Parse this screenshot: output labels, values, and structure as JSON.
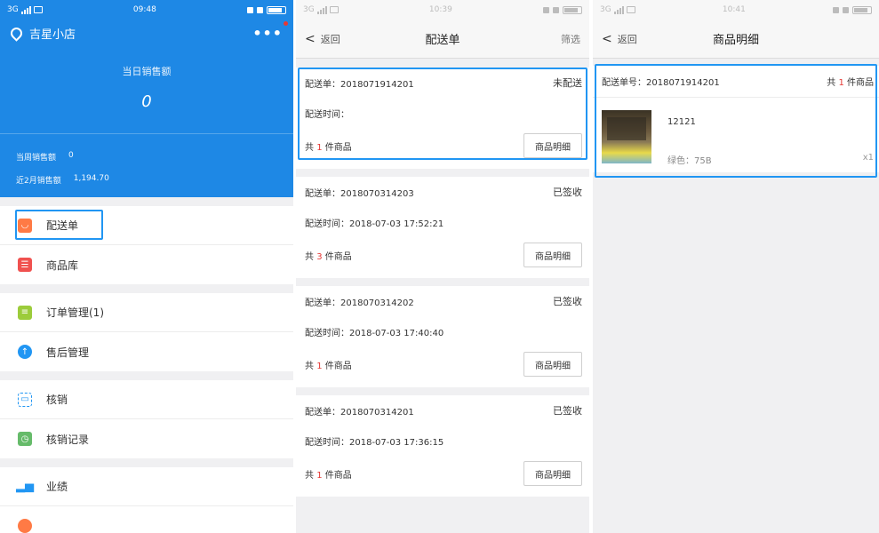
{
  "colors": {
    "primary_blue": "#1e88e5",
    "highlight_border": "#2196f3",
    "count_red": "#e53935"
  },
  "screen1": {
    "status": {
      "network": "3G",
      "time": "09:48"
    },
    "shop_name": "吉星小店",
    "more_label": "•••",
    "daily_sales_label": "当日销售额",
    "daily_sales_value": "0",
    "week_sales_label": "当周销售额",
    "week_sales_value": "0",
    "recent_sales_label": "近2月销售额",
    "recent_sales_value": "1,194.70",
    "menu": [
      {
        "label": "配送单",
        "icon": "delivery-icon"
      },
      {
        "label": "商品库",
        "icon": "product-library-icon"
      },
      {
        "label": "订单管理(1)",
        "icon": "order-management-icon"
      },
      {
        "label": "售后管理",
        "icon": "after-sales-icon"
      },
      {
        "label": "核销",
        "icon": "scan-verify-icon"
      },
      {
        "label": "核销记录",
        "icon": "verify-record-icon"
      },
      {
        "label": "业绩",
        "icon": "performance-chart-icon"
      }
    ]
  },
  "screen2": {
    "status": {
      "network": "3G",
      "time": "10:39"
    },
    "back_label": "返回",
    "title": "配送单",
    "filter_label": "筛选",
    "orders": [
      {
        "no_label": "配送单：2018071914201",
        "status": "未配送",
        "time_label": "配送时间：",
        "count_prefix": "共",
        "count": "1",
        "count_suffix": "件商品",
        "button": "商品明细"
      },
      {
        "no_label": "配送单：2018070314203",
        "status": "已签收",
        "time_label": "配送时间：2018-07-03 17:52:21",
        "count_prefix": "共",
        "count": "3",
        "count_suffix": "件商品",
        "button": "商品明细"
      },
      {
        "no_label": "配送单：2018070314202",
        "status": "已签收",
        "time_label": "配送时间：2018-07-03 17:40:40",
        "count_prefix": "共",
        "count": "1",
        "count_suffix": "件商品",
        "button": "商品明细"
      },
      {
        "no_label": "配送单：2018070314201",
        "status": "已签收",
        "time_label": "配送时间：2018-07-03 17:36:15",
        "count_prefix": "共",
        "count": "1",
        "count_suffix": "件商品",
        "button": "商品明细"
      }
    ]
  },
  "screen3": {
    "status": {
      "network": "3G",
      "time": "10:41"
    },
    "back_label": "返回",
    "title": "商品明细",
    "order_no_label": "配送单号：2018071914201",
    "count_prefix": "共",
    "count": "1",
    "count_suffix": "件商品",
    "product": {
      "name": "12121",
      "spec": "绿色：75B",
      "qty": "x1"
    }
  }
}
